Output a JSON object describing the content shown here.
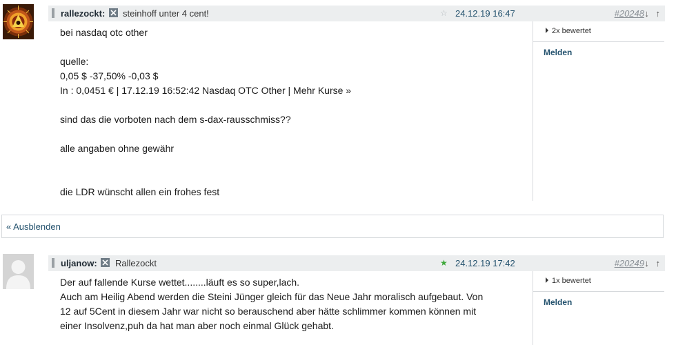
{
  "posts": [
    {
      "username": "rallezockt:",
      "subject": "steinhoff unter 4 cent!",
      "date": "24.12.19 16:47",
      "post_number": "#20248",
      "nav_arrows": "↓ ↑",
      "star_icon": "☆",
      "star_color": "#b6bcc0",
      "body_lines": [
        "bei nasdaq otc other",
        "",
        "quelle:",
        "0,05 $ -37,50% -0,03 $",
        "In : 0,0451 € | 17.12.19 16:52:42 Nasdaq OTC Other | Mehr Kurse »",
        "",
        "sind das die vorboten nach dem s-dax-rausschmiss??",
        "",
        "alle angaben ohne gewähr",
        "",
        "",
        "die LDR wünscht allen ein frohes fest"
      ],
      "rating": "2x bewertet",
      "report": "Melden"
    },
    {
      "username": "uljanow:",
      "subject": "Rallezockt",
      "date": "24.12.19 17:42",
      "post_number": "#20249",
      "nav_arrows": "↓ ↑",
      "star_icon": "★",
      "star_color": "#3ea83a",
      "body_lines": [
        "Der auf fallende Kurse wettet........läuft es so super,lach.",
        "Auch am Heilig Abend werden die Steini Jünger gleich für das Neue Jahr moralisch aufgebaut. Von",
        "12 auf 5Cent in diesem Jahr war nicht so berauschend aber hätte schlimmer kommen können mit",
        "einer Insolvenz,puh da hat man aber noch einmal Glück gehabt."
      ],
      "rating": "1x bewertet",
      "report": "Melden"
    }
  ],
  "hide_link": "« Ausblenden"
}
